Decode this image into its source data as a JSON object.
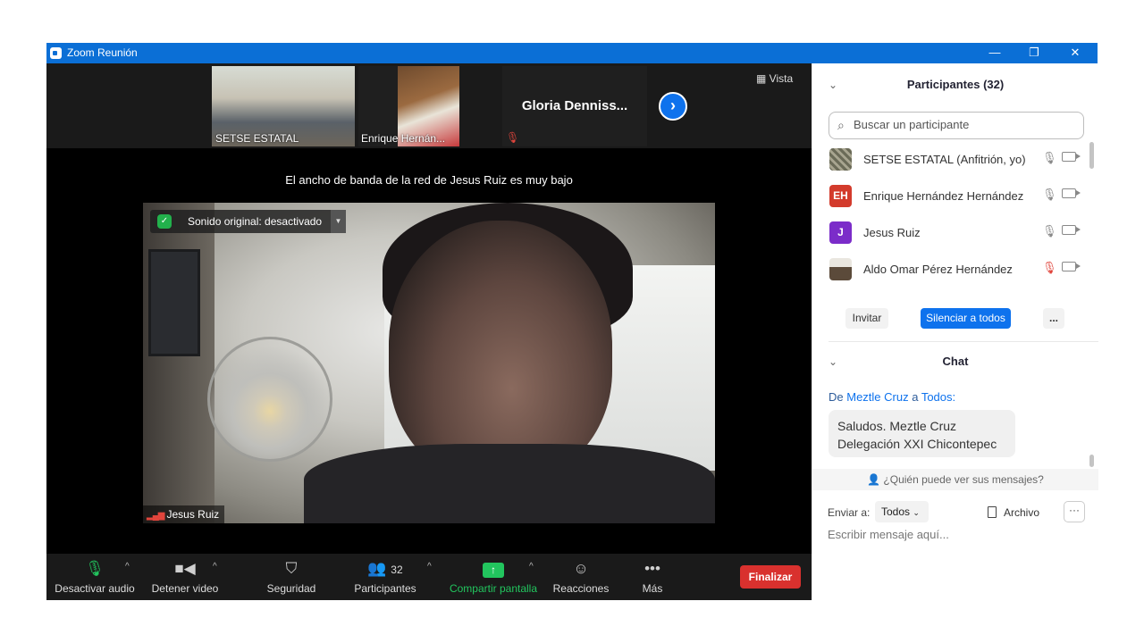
{
  "window": {
    "title": "Zoom Reunión",
    "controls": [
      "—",
      "❐",
      "✕"
    ]
  },
  "strip": {
    "thumbnails": [
      {
        "name": "SETSE ESTATAL"
      },
      {
        "name": "Enrique Hernán..."
      },
      {
        "name": "Gloria  Denniss..."
      }
    ],
    "next_icon": "›",
    "view_label": "Vista"
  },
  "banner": "El ancho de banda de la red de Jesus Ruiz es muy bajo",
  "speaker": {
    "audio_status": "Sonido original: desactivado",
    "name": "Jesus Ruiz"
  },
  "toolbar": {
    "items": [
      {
        "label": "Desactivar audio",
        "icon": "microphone-icon"
      },
      {
        "label": "Detener video",
        "icon": "video-camera-icon"
      },
      {
        "label": "Seguridad",
        "icon": "shield-icon"
      },
      {
        "label": "Participantes",
        "icon": "participants-icon",
        "count": "32"
      },
      {
        "label": "Compartir pantalla",
        "icon": "share-screen-icon"
      },
      {
        "label": "Reacciones",
        "icon": "reactions-icon"
      },
      {
        "label": "Más",
        "icon": "more-icon"
      }
    ],
    "end_label": "Finalizar",
    "colors": {
      "share": "#22c55e",
      "end": "#d9312e"
    }
  },
  "participants_panel": {
    "title": "Participantes (32)",
    "search_placeholder": "Buscar un participante",
    "list": [
      {
        "name": "SETSE ESTATAL (Anfitrión, yo)",
        "avatar": "",
        "avatar_color": "#6b6b58",
        "muted": false
      },
      {
        "name": "Enrique Hernández Hernández",
        "avatar": "EH",
        "avatar_color": "#d33b2c",
        "muted": false
      },
      {
        "name": "Jesus Ruiz",
        "avatar": "J",
        "avatar_color": "#7b2cc9",
        "muted": false
      },
      {
        "name": "Aldo Omar Pérez Hernández",
        "avatar": "",
        "avatar_color": "#5b4a3a",
        "muted": true
      }
    ],
    "invite_label": "Invitar",
    "mute_all_label": "Silenciar a todos",
    "more_label": "..."
  },
  "chat_panel": {
    "title": "Chat",
    "from_prefix": "De ",
    "from_name": "Meztle Cruz",
    "from_suffix": " a ",
    "to_name": "Todos:",
    "message_line1": "Saludos. Meztle Cruz",
    "message_line2": "Delegación XXI Chicontepec",
    "who_sees": "¿Quién puede ver sus mensajes?",
    "send_to_label": "Enviar a:",
    "send_to_value": "Todos",
    "file_label": "Archivo",
    "more_label": "···",
    "input_placeholder": "Escribir mensaje aquí..."
  }
}
